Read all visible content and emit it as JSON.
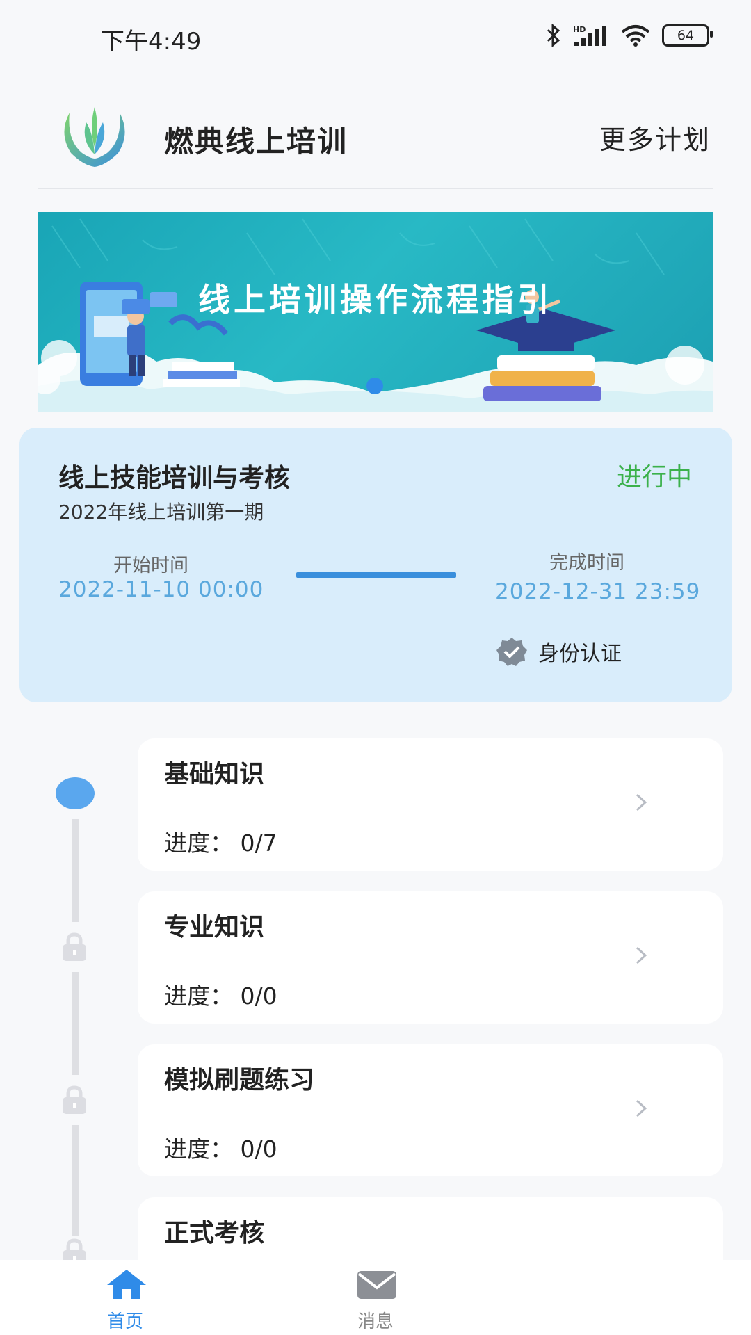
{
  "status_bar": {
    "time": "下午4:49",
    "battery": "64"
  },
  "header": {
    "title": "燃典线上培训",
    "more_plans": "更多计划"
  },
  "banner": {
    "title": "线上培训操作流程指引"
  },
  "plan": {
    "title": "线上技能培训与考核",
    "status": "进行中",
    "subtitle": "2022年线上培训第一期",
    "start_label": "开始时间",
    "start_value": "2022-11-10 00:00",
    "end_label": "完成时间",
    "end_value": "2022-12-31 23:59",
    "verify_label": "身份认证"
  },
  "courses": [
    {
      "title": "基础知识",
      "progress": "进度：  0/7"
    },
    {
      "title": "专业知识",
      "progress": "进度：  0/0"
    },
    {
      "title": "模拟刷题练习",
      "progress": "进度：  0/0"
    },
    {
      "title": "正式考核",
      "progress": ""
    }
  ],
  "tabs": [
    {
      "label": "首页",
      "icon": "home-icon",
      "active": true
    },
    {
      "label": "消息",
      "icon": "mail-icon",
      "active": false
    }
  ],
  "colors": {
    "accent": "#2f8be8",
    "status_green": "#3bb14b",
    "date_blue": "#5aa8dd",
    "card_bg": "#d9edfb",
    "banner_teal": "#1fb0c0",
    "tab_inactive": "#888888"
  }
}
